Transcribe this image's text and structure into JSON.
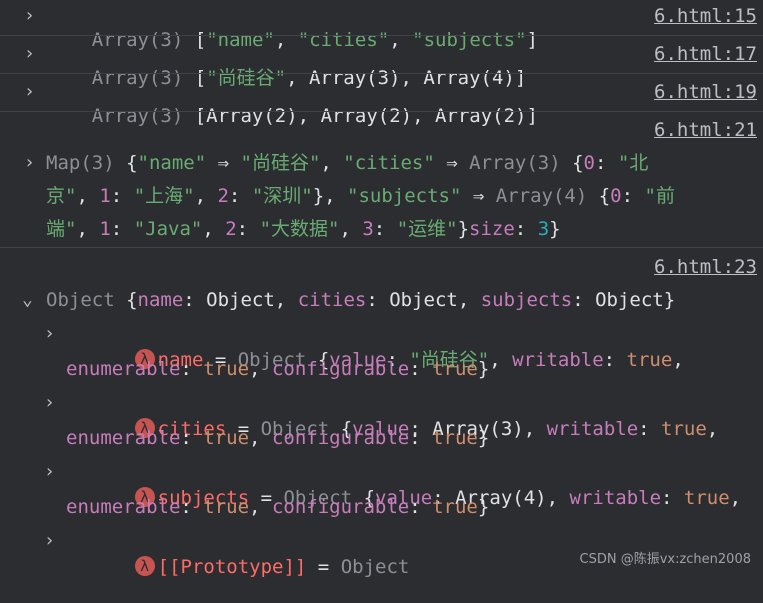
{
  "rows": [
    {
      "kind": "Array(3)",
      "text_parts": [
        {
          "t": "[",
          "c": "white"
        },
        {
          "t": "\"name\"",
          "c": "str"
        },
        {
          "t": ", ",
          "c": "white"
        },
        {
          "t": "\"cities\"",
          "c": "str"
        },
        {
          "t": ", ",
          "c": "white"
        },
        {
          "t": "\"subjects\"",
          "c": "str"
        },
        {
          "t": "]",
          "c": "white"
        }
      ],
      "link": "6.html:15"
    },
    {
      "kind": "Array(3)",
      "text_parts": [
        {
          "t": "[",
          "c": "white"
        },
        {
          "t": "\"尚硅谷\"",
          "c": "str"
        },
        {
          "t": ", Array(3), Array(4)]",
          "c": "white"
        }
      ],
      "link": "6.html:17"
    },
    {
      "kind": "Array(3)",
      "text_parts": [
        {
          "t": "[Array(2), Array(2), Array(2)]",
          "c": "white"
        }
      ],
      "link": "6.html:19"
    }
  ],
  "map_entry": {
    "link": "6.html:21",
    "line1": [
      {
        "t": "Map(3) ",
        "c": "gray"
      },
      {
        "t": "{",
        "c": "white"
      },
      {
        "t": "\"name\"",
        "c": "str"
      },
      {
        "t": " ⇒ ",
        "c": "white"
      },
      {
        "t": "\"尚硅谷\"",
        "c": "str"
      },
      {
        "t": ", ",
        "c": "white"
      },
      {
        "t": "\"cities\"",
        "c": "str"
      },
      {
        "t": " ⇒ ",
        "c": "white"
      },
      {
        "t": "Array(3) ",
        "c": "gray"
      },
      {
        "t": "{",
        "c": "white"
      },
      {
        "t": "0",
        "c": "prop"
      },
      {
        "t": ": ",
        "c": "white"
      },
      {
        "t": "\"北",
        "c": "str"
      }
    ],
    "line2": [
      {
        "t": "京\"",
        "c": "str"
      },
      {
        "t": ", ",
        "c": "white"
      },
      {
        "t": "1",
        "c": "prop"
      },
      {
        "t": ": ",
        "c": "white"
      },
      {
        "t": "\"上海\"",
        "c": "str"
      },
      {
        "t": ", ",
        "c": "white"
      },
      {
        "t": "2",
        "c": "prop"
      },
      {
        "t": ": ",
        "c": "white"
      },
      {
        "t": "\"深圳\"",
        "c": "str"
      },
      {
        "t": "}, ",
        "c": "white"
      },
      {
        "t": "\"subjects\"",
        "c": "str"
      },
      {
        "t": " ⇒ ",
        "c": "white"
      },
      {
        "t": "Array(4) ",
        "c": "gray"
      },
      {
        "t": "{",
        "c": "white"
      },
      {
        "t": "0",
        "c": "prop"
      },
      {
        "t": ": ",
        "c": "white"
      },
      {
        "t": "\"前",
        "c": "str"
      }
    ],
    "line3": [
      {
        "t": "端\"",
        "c": "str"
      },
      {
        "t": ", ",
        "c": "white"
      },
      {
        "t": "1",
        "c": "prop"
      },
      {
        "t": ": ",
        "c": "white"
      },
      {
        "t": "\"Java\"",
        "c": "str"
      },
      {
        "t": ", ",
        "c": "white"
      },
      {
        "t": "2",
        "c": "prop"
      },
      {
        "t": ": ",
        "c": "white"
      },
      {
        "t": "\"大数据\"",
        "c": "str"
      },
      {
        "t": ", ",
        "c": "white"
      },
      {
        "t": "3",
        "c": "prop"
      },
      {
        "t": ": ",
        "c": "white"
      },
      {
        "t": "\"运维\"",
        "c": "str"
      },
      {
        "t": "}",
        "c": "white"
      },
      {
        "t": "size",
        "c": "prop"
      },
      {
        "t": ": ",
        "c": "white"
      },
      {
        "t": "3",
        "c": "num"
      },
      {
        "t": "}",
        "c": "white"
      }
    ]
  },
  "object_entry": {
    "link": "6.html:23",
    "header": [
      {
        "t": "Object ",
        "c": "gray"
      },
      {
        "t": "{",
        "c": "white"
      },
      {
        "t": "name",
        "c": "prop"
      },
      {
        "t": ": Object, ",
        "c": "white"
      },
      {
        "t": "cities",
        "c": "prop"
      },
      {
        "t": ": Object, ",
        "c": "white"
      },
      {
        "t": "subjects",
        "c": "prop"
      },
      {
        "t": ": Object}",
        "c": "white"
      }
    ],
    "props": [
      {
        "name": "name",
        "line1": [
          {
            "t": " = ",
            "c": "white"
          },
          {
            "t": "Object ",
            "c": "gray"
          },
          {
            "t": "{",
            "c": "white"
          },
          {
            "t": "value",
            "c": "prop"
          },
          {
            "t": ": ",
            "c": "white"
          },
          {
            "t": "\"尚硅谷\"",
            "c": "str"
          },
          {
            "t": ", ",
            "c": "white"
          },
          {
            "t": "writable",
            "c": "prop"
          },
          {
            "t": ": ",
            "c": "white"
          },
          {
            "t": "true",
            "c": "kw"
          },
          {
            "t": ",",
            "c": "white"
          }
        ],
        "line2": [
          {
            "t": "enumerable",
            "c": "prop"
          },
          {
            "t": ": ",
            "c": "white"
          },
          {
            "t": "true",
            "c": "kw"
          },
          {
            "t": ", ",
            "c": "white"
          },
          {
            "t": "configurable",
            "c": "prop"
          },
          {
            "t": ": ",
            "c": "white"
          },
          {
            "t": "true",
            "c": "kw"
          },
          {
            "t": "}",
            "c": "white"
          }
        ]
      },
      {
        "name": "cities",
        "line1": [
          {
            "t": " = ",
            "c": "white"
          },
          {
            "t": "Object ",
            "c": "gray"
          },
          {
            "t": "{",
            "c": "white"
          },
          {
            "t": "value",
            "c": "prop"
          },
          {
            "t": ": Array(3), ",
            "c": "white"
          },
          {
            "t": "writable",
            "c": "prop"
          },
          {
            "t": ": ",
            "c": "white"
          },
          {
            "t": "true",
            "c": "kw"
          },
          {
            "t": ",",
            "c": "white"
          }
        ],
        "line2": [
          {
            "t": "enumerable",
            "c": "prop"
          },
          {
            "t": ": ",
            "c": "white"
          },
          {
            "t": "true",
            "c": "kw"
          },
          {
            "t": ", ",
            "c": "white"
          },
          {
            "t": "configurable",
            "c": "prop"
          },
          {
            "t": ": ",
            "c": "white"
          },
          {
            "t": "true",
            "c": "kw"
          },
          {
            "t": "}",
            "c": "white"
          }
        ]
      },
      {
        "name": "subjects",
        "line1": [
          {
            "t": " = ",
            "c": "white"
          },
          {
            "t": "Object ",
            "c": "gray"
          },
          {
            "t": "{",
            "c": "white"
          },
          {
            "t": "value",
            "c": "prop"
          },
          {
            "t": ": Array(4), ",
            "c": "white"
          },
          {
            "t": "writable",
            "c": "prop"
          },
          {
            "t": ": ",
            "c": "white"
          },
          {
            "t": "true",
            "c": "kw"
          },
          {
            "t": ",",
            "c": "white"
          }
        ],
        "line2": [
          {
            "t": "enumerable",
            "c": "prop"
          },
          {
            "t": ": ",
            "c": "white"
          },
          {
            "t": "true",
            "c": "kw"
          },
          {
            "t": ", ",
            "c": "white"
          },
          {
            "t": "configurable",
            "c": "prop"
          },
          {
            "t": ": ",
            "c": "white"
          },
          {
            "t": "true",
            "c": "kw"
          },
          {
            "t": "}",
            "c": "white"
          }
        ]
      },
      {
        "name": "[[Prototype]]",
        "line1": [
          {
            "t": " = ",
            "c": "white"
          },
          {
            "t": "Object",
            "c": "gray"
          }
        ],
        "line2": []
      }
    ]
  },
  "lambda_glyph": "λ",
  "expand_glyph": "›",
  "expanded_glyph": "⌄",
  "watermark": "CSDN @陈振vx:zchen2008"
}
